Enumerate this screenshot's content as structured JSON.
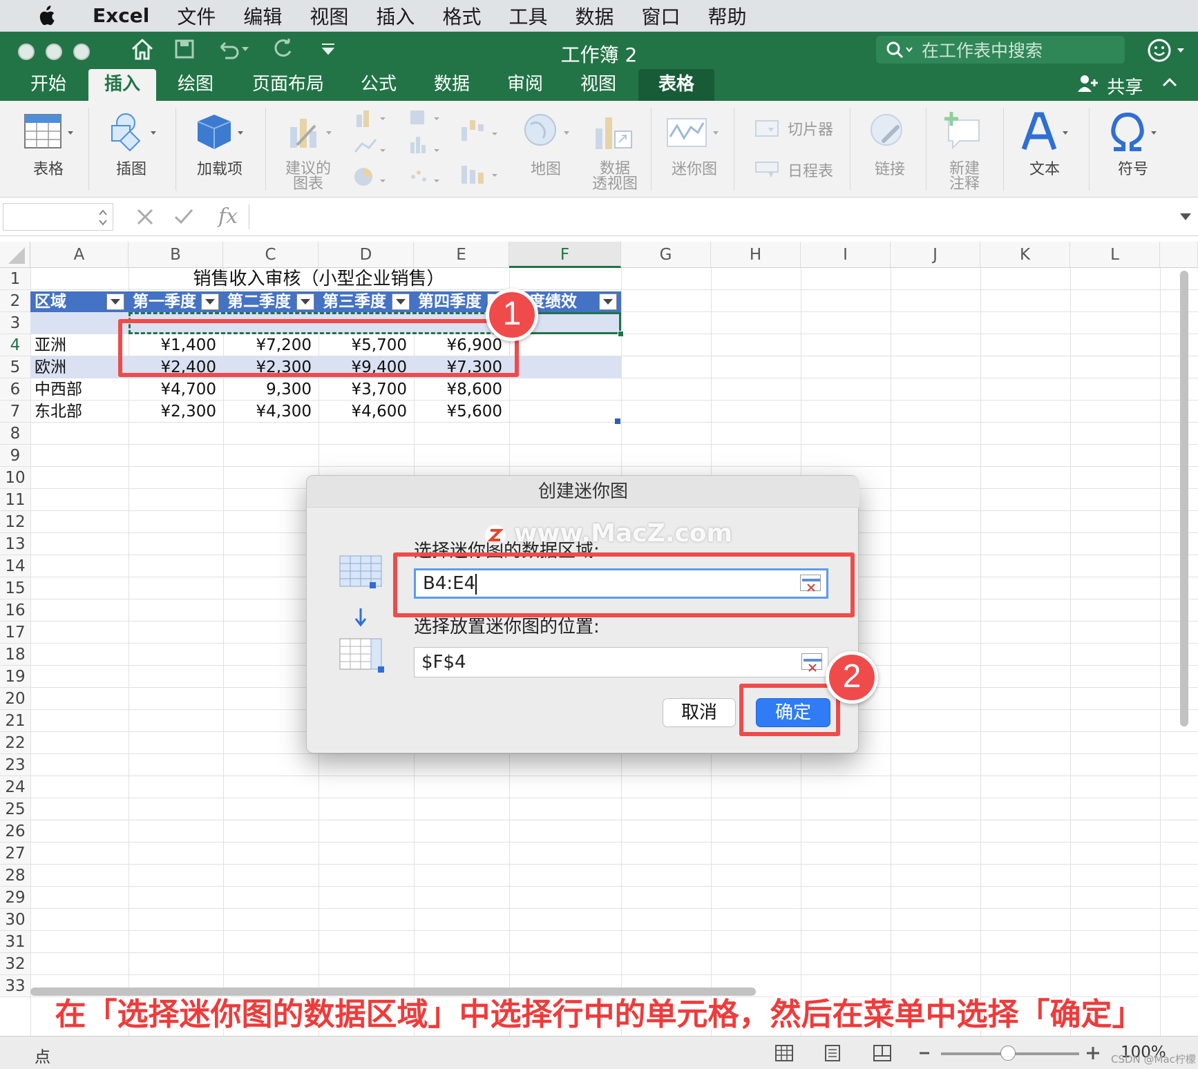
{
  "menubar": {
    "app_name": "Excel",
    "items": [
      "文件",
      "编辑",
      "视图",
      "插入",
      "格式",
      "工具",
      "数据",
      "窗口",
      "帮助"
    ]
  },
  "window": {
    "title": "工作簿 2",
    "search_placeholder": "在工作表中搜索"
  },
  "ribbon_tabs": {
    "items": [
      "开始",
      "插入",
      "绘图",
      "页面布局",
      "公式",
      "数据",
      "审阅",
      "视图",
      "表格"
    ],
    "active": "插入",
    "share": "共享"
  },
  "ribbon": {
    "table": "表格",
    "illustrations": "插图",
    "addins": "加载项",
    "rec_charts_1": "建议的",
    "rec_charts_2": "图表",
    "maps": "地图",
    "pivot_1": "数据",
    "pivot_2": "透视图",
    "sparklines": "迷你图",
    "slicer": "切片器",
    "timeline": "日程表",
    "link": "链接",
    "comment_1": "新建",
    "comment_2": "注释",
    "text": "文本",
    "symbol": "符号"
  },
  "formula_bar": {
    "name_box": "",
    "fx": "fx",
    "content": ""
  },
  "columns": [
    "A",
    "B",
    "C",
    "D",
    "E",
    "F",
    "G",
    "H",
    "I",
    "J",
    "K",
    "L"
  ],
  "rows": [
    "1",
    "2",
    "3",
    "4",
    "5",
    "6",
    "7",
    "8",
    "9",
    "10",
    "11",
    "12",
    "13",
    "14",
    "15",
    "16",
    "17",
    "18",
    "19",
    "20",
    "21",
    "22",
    "23",
    "24",
    "25",
    "26",
    "27",
    "28",
    "29",
    "30",
    "31",
    "32",
    "33"
  ],
  "sheet": {
    "title": "销售收入审核（小型企业销售）",
    "headers": [
      "区域",
      "第一季度",
      "第二季度",
      "第三季度",
      "第四季度",
      "年度绩效"
    ],
    "data": [
      [
        "亚洲",
        "¥1,400",
        "¥7,200",
        "¥5,700",
        "¥6,900",
        ""
      ],
      [
        "欧洲",
        "¥2,400",
        "¥2,300",
        "¥9,400",
        "¥7,300",
        ""
      ],
      [
        "中西部",
        "¥4,700",
        "9,300",
        "¥3,700",
        "¥8,600",
        ""
      ],
      [
        "东北部",
        "¥2,300",
        "¥4,300",
        "¥4,600",
        "¥5,600",
        ""
      ]
    ]
  },
  "dialog": {
    "title": "创建迷你图",
    "data_range_label": "选择迷你图的数据区域:",
    "data_range_value": "B4:E4",
    "location_label": "选择放置迷你图的位置:",
    "location_value": "$F$4",
    "cancel": "取消",
    "ok": "确定"
  },
  "watermark": "www.MacZ.com",
  "annotations": {
    "badge_1": "1",
    "badge_2": "2",
    "color": "#ef4b4b"
  },
  "caption": "在「选择迷你图的数据区域」中选择行中的单元格，然后在菜单中选择「确定」",
  "status": {
    "mode": "点",
    "zoom": "100%",
    "credit": "CSDN @Mac柠檬"
  },
  "colors": {
    "excel_green": "#227447",
    "table_header": "#4472c4",
    "table_band": "#d9e1f2",
    "ok_button": "#2f7cf6"
  }
}
